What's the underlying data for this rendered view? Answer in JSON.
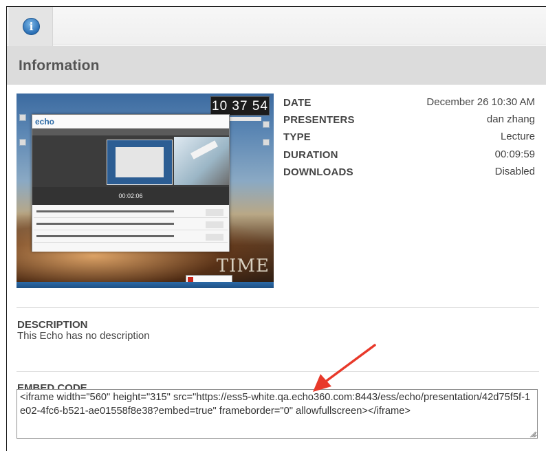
{
  "tab": {
    "icon": "info-icon",
    "glyph": "i"
  },
  "section": {
    "title": "Information"
  },
  "thumbnail": {
    "clock": "10 37 54",
    "app_logo": "echo",
    "timer": "00:02:06",
    "overlay_text": "TIME"
  },
  "details": [
    {
      "label": "DATE",
      "value": "December 26 10:30 AM"
    },
    {
      "label": "PRESENTERS",
      "value": "dan zhang"
    },
    {
      "label": "TYPE",
      "value": "Lecture"
    },
    {
      "label": "DURATION",
      "value": "00:09:59"
    },
    {
      "label": "DOWNLOADS",
      "value": "Disabled"
    }
  ],
  "description": {
    "label": "DESCRIPTION",
    "text": "This Echo has no description"
  },
  "embed": {
    "label": "EMBED CODE",
    "code": "<iframe width=\"560\" height=\"315\" src=\"https://ess5-white.qa.echo360.com:8443/ess/echo/presentation/42d75f5f-1e02-4fc6-b521-ae01558f8e38?embed=true\" frameborder=\"0\" allowfullscreen></iframe>"
  },
  "colors": {
    "accent": "#2a6fb5",
    "annotation_arrow": "#e8392a",
    "header_bg": "#dcdcdc"
  }
}
